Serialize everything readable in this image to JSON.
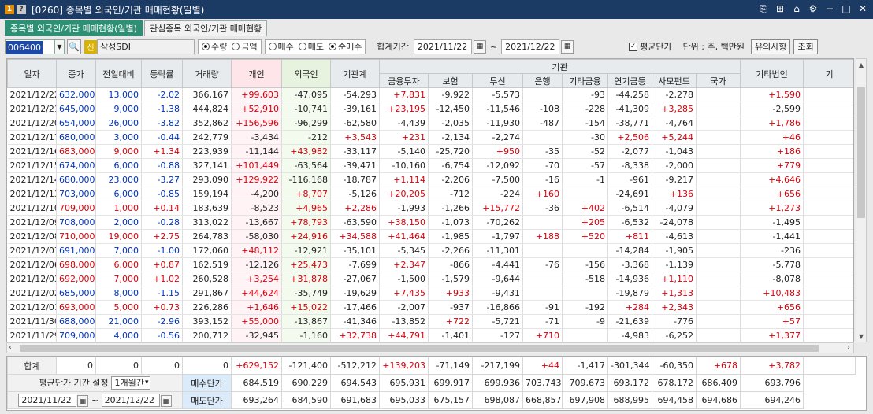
{
  "window": {
    "badge1": "1",
    "badge2": "?",
    "title": "[0260] 종목별 외국인/기관 매매현황(일별)",
    "controls": [
      "⎘",
      "⊞",
      "⌂",
      "⚙",
      "−",
      "□",
      "✕"
    ]
  },
  "tabs": [
    {
      "label": "종목별 외국인/기관 매매현황(일별)",
      "active": true
    },
    {
      "label": "관심종목 외국인/기관 매매현황",
      "active": false
    }
  ],
  "toolbar": {
    "code": "006400",
    "search_icon": "🔍",
    "badge": "신",
    "stock_name": "삼성SDI",
    "unit_radios": [
      {
        "label": "수량",
        "checked": true
      },
      {
        "label": "금액",
        "checked": false
      }
    ],
    "side_radios": [
      {
        "label": "매수",
        "checked": false
      },
      {
        "label": "매도",
        "checked": false
      },
      {
        "label": "순매수",
        "checked": true
      }
    ],
    "period_label": "합계기간",
    "date_from": "2021/11/22",
    "date_to": "2021/12/22",
    "tilde": "~",
    "avg_checkbox_label": "평균단가",
    "unit_text": "단위 : 주, 백만원",
    "notice_button": "유의사항",
    "query_button": "조회"
  },
  "grid": {
    "group_header": "기관",
    "headers": [
      "일자",
      "종가",
      "전일대비",
      "등락률",
      "거래량",
      "개인",
      "외국인",
      "기관계",
      "금융투자",
      "보험",
      "투신",
      "은행",
      "기타금융",
      "연기금등",
      "사모펀드",
      "국가",
      "기타법인",
      "기"
    ],
    "rows": [
      [
        "2021/12/22",
        "632,000",
        "13,000",
        "-2.02",
        "366,167",
        "+99,603",
        "-47,095",
        "-54,293",
        "+7,831",
        "-9,922",
        "-5,573",
        "",
        "-93",
        "-44,258",
        "-2,278",
        "",
        "+1,590",
        ""
      ],
      [
        "2021/12/21",
        "645,000",
        "9,000",
        "-1.38",
        "444,824",
        "+52,910",
        "-10,741",
        "-39,161",
        "+23,195",
        "-12,450",
        "-11,546",
        "-108",
        "-228",
        "-41,309",
        "+3,285",
        "",
        "-2,599",
        ""
      ],
      [
        "2021/12/20",
        "654,000",
        "26,000",
        "-3.82",
        "352,862",
        "+156,596",
        "-96,299",
        "-62,580",
        "-4,439",
        "-2,035",
        "-11,930",
        "-487",
        "-154",
        "-38,771",
        "-4,764",
        "",
        "+1,786",
        ""
      ],
      [
        "2021/12/17",
        "680,000",
        "3,000",
        "-0.44",
        "242,779",
        "-3,434",
        "-212",
        "+3,543",
        "+231",
        "-2,134",
        "-2,274",
        "",
        "-30",
        "+2,506",
        "+5,244",
        "",
        "+46",
        ""
      ],
      [
        "2021/12/16",
        "683,000",
        "9,000",
        "+1.34",
        "223,939",
        "-11,144",
        "+43,982",
        "-33,117",
        "-5,140",
        "-25,720",
        "+950",
        "-35",
        "-52",
        "-2,077",
        "-1,043",
        "",
        "+186",
        ""
      ],
      [
        "2021/12/15",
        "674,000",
        "6,000",
        "-0.88",
        "327,141",
        "+101,449",
        "-63,564",
        "-39,471",
        "-10,160",
        "-6,754",
        "-12,092",
        "-70",
        "-57",
        "-8,338",
        "-2,000",
        "",
        "+779",
        ""
      ],
      [
        "2021/12/14",
        "680,000",
        "23,000",
        "-3.27",
        "293,090",
        "+129,922",
        "-116,168",
        "-18,787",
        "+1,114",
        "-2,206",
        "-7,500",
        "-16",
        "-1",
        "-961",
        "-9,217",
        "",
        "+4,646",
        ""
      ],
      [
        "2021/12/13",
        "703,000",
        "6,000",
        "-0.85",
        "159,194",
        "-4,200",
        "+8,707",
        "-5,126",
        "+20,205",
        "-712",
        "-224",
        "+160",
        "",
        "-24,691",
        "+136",
        "",
        "+656",
        ""
      ],
      [
        "2021/12/10",
        "709,000",
        "1,000",
        "+0.14",
        "183,639",
        "-8,523",
        "+4,965",
        "+2,286",
        "-1,993",
        "-1,266",
        "+15,772",
        "-36",
        "+402",
        "-6,514",
        "-4,079",
        "",
        "+1,273",
        ""
      ],
      [
        "2021/12/09",
        "708,000",
        "2,000",
        "-0.28",
        "313,022",
        "-13,667",
        "+78,793",
        "-63,590",
        "+38,150",
        "-1,073",
        "-70,262",
        "",
        "+205",
        "-6,532",
        "-24,078",
        "",
        "-1,495",
        ""
      ],
      [
        "2021/12/08",
        "710,000",
        "19,000",
        "+2.75",
        "264,783",
        "-58,030",
        "+24,916",
        "+34,588",
        "+41,464",
        "-1,985",
        "-1,797",
        "+188",
        "+520",
        "+811",
        "-4,613",
        "",
        "-1,441",
        ""
      ],
      [
        "2021/12/07",
        "691,000",
        "7,000",
        "-1.00",
        "172,060",
        "+48,112",
        "-12,921",
        "-35,101",
        "-5,345",
        "-2,266",
        "-11,301",
        "",
        "",
        "-14,284",
        "-1,905",
        "",
        "-236",
        ""
      ],
      [
        "2021/12/06",
        "698,000",
        "6,000",
        "+0.87",
        "162,519",
        "-12,126",
        "+25,473",
        "-7,699",
        "+2,347",
        "-866",
        "-4,441",
        "-76",
        "-156",
        "-3,368",
        "-1,139",
        "",
        "-5,778",
        ""
      ],
      [
        "2021/12/03",
        "692,000",
        "7,000",
        "+1.02",
        "260,528",
        "+3,254",
        "+31,878",
        "-27,067",
        "-1,500",
        "-1,579",
        "-9,644",
        "",
        "-518",
        "-14,936",
        "+1,110",
        "",
        "-8,078",
        ""
      ],
      [
        "2021/12/02",
        "685,000",
        "8,000",
        "-1.15",
        "291,867",
        "+44,624",
        "-35,749",
        "-19,629",
        "+7,435",
        "+933",
        "-9,431",
        "",
        "",
        "-19,879",
        "+1,313",
        "",
        "+10,483",
        ""
      ],
      [
        "2021/12/01",
        "693,000",
        "5,000",
        "+0.73",
        "226,286",
        "+1,646",
        "+15,022",
        "-17,466",
        "-2,007",
        "-937",
        "-16,866",
        "-91",
        "-192",
        "+284",
        "+2,343",
        "",
        "+656",
        ""
      ],
      [
        "2021/11/30",
        "688,000",
        "21,000",
        "-2.96",
        "393,152",
        "+55,000",
        "-13,867",
        "-41,346",
        "-13,852",
        "+722",
        "-5,721",
        "-71",
        "-9",
        "-21,639",
        "-776",
        "",
        "+57",
        ""
      ],
      [
        "2021/11/29",
        "709,000",
        "4,000",
        "-0.56",
        "200,712",
        "-32,945",
        "-1,160",
        "+32,738",
        "+44,791",
        "-1,401",
        "-127",
        "+710",
        "",
        "-4,983",
        "-6,252",
        "",
        "+1,377",
        ""
      ]
    ]
  },
  "summary": {
    "total_label": "합계",
    "totals": [
      "0",
      "0",
      "0",
      "0",
      "+629,152",
      "-121,400",
      "-512,212",
      "+139,203",
      "-71,149",
      "-217,199",
      "+44",
      "-1,417",
      "-301,344",
      "-60,350",
      "+678",
      "+3,782"
    ],
    "avg_period_label": "평균단가 기간 설정",
    "avg_period_value": "1개월간",
    "buy_label": "매수단가",
    "buy_values": [
      "684,519",
      "690,229",
      "694,543",
      "695,931",
      "699,917",
      "699,936",
      "703,743",
      "709,673",
      "693,172",
      "678,172",
      "686,409",
      "693,796"
    ],
    "sell_label": "매도단가",
    "sell_values": [
      "693,264",
      "684,590",
      "691,683",
      "695,033",
      "675,157",
      "698,087",
      "668,857",
      "697,908",
      "688,995",
      "694,458",
      "694,686",
      "694,246"
    ],
    "date_from": "2021/11/22",
    "date_to": "2021/12/22",
    "tilde": "~"
  }
}
